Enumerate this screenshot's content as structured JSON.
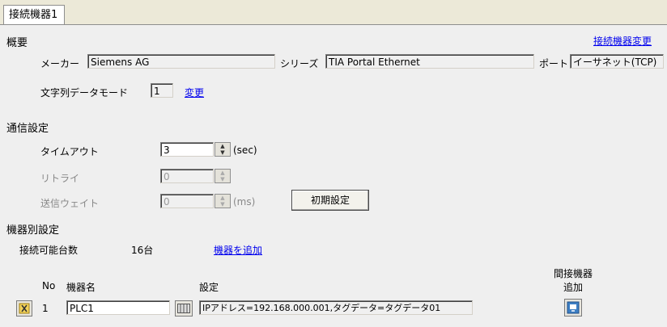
{
  "tab": {
    "label": "接続機器1"
  },
  "overview": {
    "heading": "概要",
    "change_device_link": "接続機器変更",
    "maker_label": "メーカー",
    "maker_value": "Siemens AG",
    "series_label": "シリーズ",
    "series_value": "TIA Portal Ethernet",
    "port_label": "ポート",
    "port_value": "イーサネット(TCP)",
    "string_mode_label": "文字列データモード",
    "string_mode_value": "1",
    "string_mode_change_link": "変更"
  },
  "comm": {
    "heading": "通信設定",
    "timeout_label": "タイムアウト",
    "timeout_value": "3",
    "timeout_unit": "(sec)",
    "retry_label": "リトライ",
    "retry_value": "0",
    "wait_label": "送信ウェイト",
    "wait_value": "0",
    "wait_unit": "(ms)",
    "init_button": "初期設定"
  },
  "device_settings": {
    "heading": "機器別設定",
    "connectable_label": "接続可能台数",
    "connectable_value": "16台",
    "add_device_link": "機器を追加",
    "col_no": "No",
    "col_name": "機器名",
    "col_settings": "設定",
    "col_indirect_line1": "間接機器",
    "col_indirect_line2": "追加",
    "rows": [
      {
        "no": "1",
        "name": "PLC1",
        "settings": "IPアドレス=192.168.000.001,タグデータ=タグデータ01"
      }
    ]
  }
}
